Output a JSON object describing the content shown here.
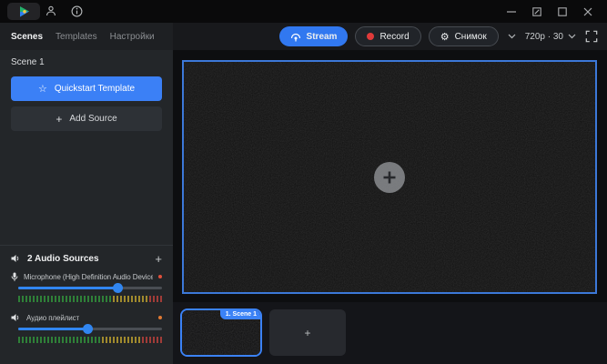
{
  "tabs": {
    "items": [
      {
        "label": "Scenes",
        "active": true
      },
      {
        "label": "Templates",
        "active": false
      },
      {
        "label": "Настройки",
        "active": false
      }
    ]
  },
  "toolbar": {
    "stream": {
      "label": "Stream"
    },
    "record": {
      "label": "Record"
    },
    "snapshot": {
      "label": "Снимок"
    },
    "resolution": {
      "label": "720p · 30"
    }
  },
  "sidebar": {
    "scene_title": "Scene 1",
    "quickstart": {
      "label": "Quickstart Template"
    },
    "add_source": {
      "label": "Add Source"
    },
    "audio": {
      "header": "2 Audio Sources",
      "add_label": "+",
      "sources": [
        {
          "name": "Microphone (High Definition Audio Device)",
          "volume_pct": 69,
          "status_dot_color": "#e0503c",
          "meter": {
            "green": 26,
            "yellow": 10,
            "red": 4
          }
        },
        {
          "name": "Аудио плейлист",
          "volume_pct": 48,
          "status_dot_color": "#e07a33",
          "meter": {
            "green": 23,
            "yellow": 11,
            "red": 6
          }
        }
      ]
    }
  },
  "scenes_strip": {
    "active_scene": {
      "label": "1. Scene 1"
    },
    "add_scene": {
      "label": "+"
    }
  },
  "icons": {
    "star": "☆",
    "gear": "⚙",
    "plus": "+"
  },
  "colors": {
    "accent_blue": "#3b82f6",
    "stream_blue": "#3178f0",
    "record_red": "#e03a3a",
    "slider_blue": "#3186f0",
    "meter_green": "#2f8038",
    "meter_yellow": "#a08a2d",
    "meter_red": "#a03c38",
    "preview_border": "#3c78d8"
  }
}
